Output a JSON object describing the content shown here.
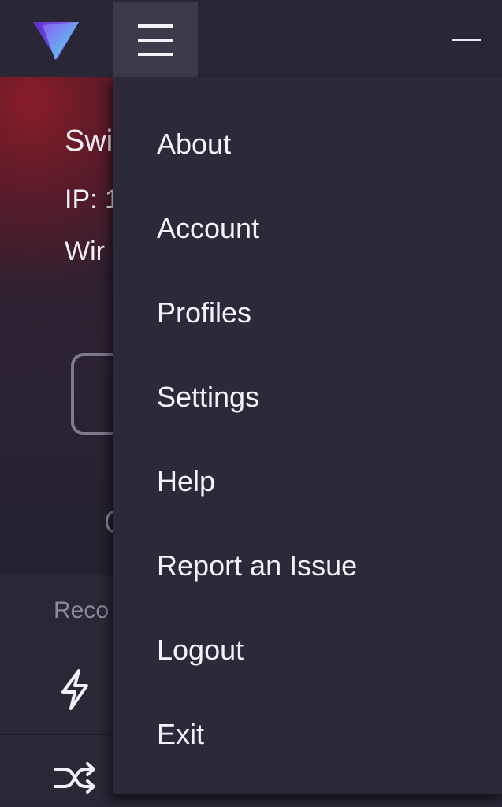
{
  "app": {
    "logo_icon": "proton-vpn-logo-icon",
    "accent_gradient": [
      "#7b4cf0",
      "#5ef0dc"
    ]
  },
  "topbar": {
    "menu_icon": "hamburger-menu-icon",
    "minimize_icon": "minimize-icon"
  },
  "status": {
    "country": "Swi",
    "ip": "IP: 1",
    "protocol": "Wir"
  },
  "lower": {
    "recommended_label": "Reco",
    "quick_connect_icon": "lightning-icon",
    "random_connect_icon": "shuffle-icon"
  },
  "menu": {
    "items": [
      {
        "label": "About"
      },
      {
        "label": "Account"
      },
      {
        "label": "Profiles"
      },
      {
        "label": "Settings"
      },
      {
        "label": "Help"
      },
      {
        "label": "Report an Issue"
      },
      {
        "label": "Logout"
      },
      {
        "label": "Exit"
      }
    ]
  }
}
